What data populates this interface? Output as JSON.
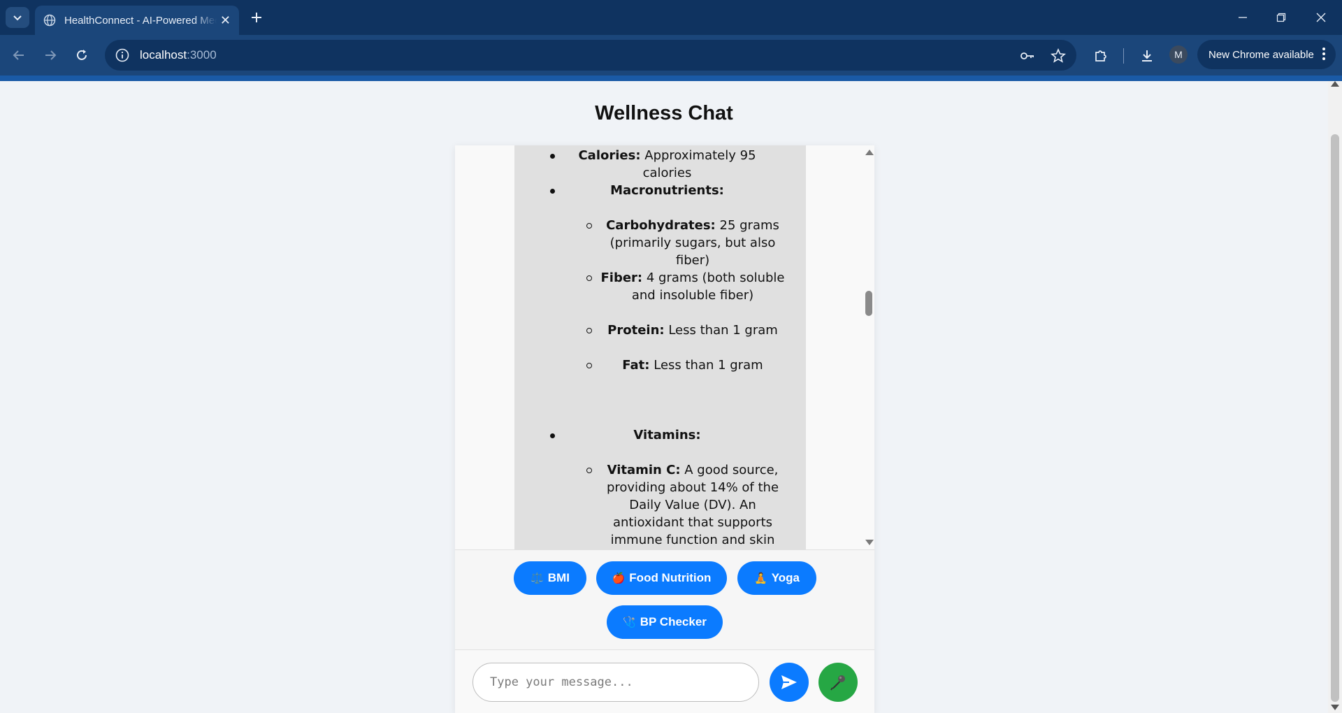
{
  "browser": {
    "tab_title": "HealthConnect - AI-Powered Medical Assistant",
    "url_host": "localhost",
    "url_port": ":3000",
    "update_label": "New Chrome available",
    "profile_initial": "M"
  },
  "page": {
    "title": "Wellness Chat"
  },
  "nutrition": {
    "calories": {
      "label": "Calories:",
      "value": "Approximately 95 calories"
    },
    "macros_heading": "Macronutrients:",
    "macros": [
      {
        "label": "Carbohydrates:",
        "value": "25 grams (primarily sugars, but also fiber)"
      },
      {
        "label": "Fiber:",
        "value": "4 grams (both soluble and insoluble fiber)"
      },
      {
        "label": "Protein:",
        "value": "Less than 1 gram"
      },
      {
        "label": "Fat:",
        "value": "Less than 1 gram"
      }
    ],
    "vitamins_heading": "Vitamins:",
    "vitamins": [
      {
        "label": "Vitamin C:",
        "value": "A good source, providing about 14% of the Daily Value (DV). An antioxidant that supports immune function and skin health."
      }
    ]
  },
  "quick_actions": [
    {
      "icon": "⚖️",
      "label": "BMI"
    },
    {
      "icon": "🍎",
      "label": "Food Nutrition"
    },
    {
      "icon": "🧘",
      "label": "Yoga"
    },
    {
      "icon": "🩺",
      "label": "BP Checker"
    }
  ],
  "composer": {
    "placeholder": "Type your message...",
    "value": ""
  },
  "colors": {
    "primary": "#0b7bff",
    "mic": "#26a744",
    "bubble": "#e0e0e0"
  }
}
